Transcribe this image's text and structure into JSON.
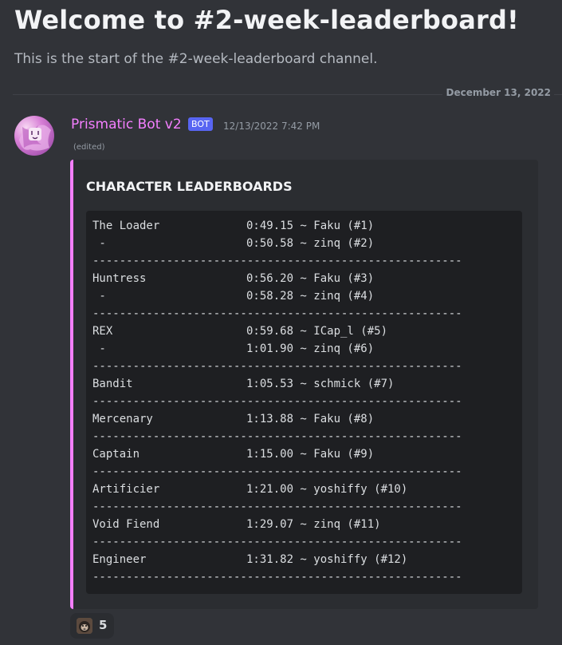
{
  "channel": {
    "welcome_title": "Welcome to #2-week-leaderboard!",
    "welcome_subtitle": "This is the start of the #2-week-leaderboard channel."
  },
  "divider": {
    "date": "December 13, 2022"
  },
  "message": {
    "author": "Prismatic Bot v2",
    "bot_tag": "BOT",
    "timestamp": "12/13/2022 7:42 PM",
    "edited": "(edited)",
    "embed": {
      "accent_color": "#f47fff",
      "title": "CHARACTER LEADERBOARDS",
      "separator": "-------------------------------------------------------",
      "groups": [
        {
          "rows": [
            {
              "name": "The Loader",
              "entry": "0:49.15 ~ Faku (#1)"
            },
            {
              "name": " -",
              "entry": "0:50.58 ~ zinq (#2)"
            }
          ]
        },
        {
          "rows": [
            {
              "name": "Huntress",
              "entry": "0:56.20 ~ Faku (#3)"
            },
            {
              "name": " -",
              "entry": "0:58.28 ~ zinq (#4)"
            }
          ]
        },
        {
          "rows": [
            {
              "name": "REX",
              "entry": "0:59.68 ~ ICap_l (#5)"
            },
            {
              "name": " -",
              "entry": "1:01.90 ~ zinq (#6)"
            }
          ]
        },
        {
          "rows": [
            {
              "name": "Bandit",
              "entry": "1:05.53 ~ schmick (#7)"
            }
          ]
        },
        {
          "rows": [
            {
              "name": "Mercenary",
              "entry": "1:13.88 ~ Faku (#8)"
            }
          ]
        },
        {
          "rows": [
            {
              "name": "Captain",
              "entry": "1:15.00 ~ Faku (#9)"
            }
          ]
        },
        {
          "rows": [
            {
              "name": "Artificier",
              "entry": "1:21.00 ~ yoshiffy (#10)"
            }
          ]
        },
        {
          "rows": [
            {
              "name": "Void Fiend",
              "entry": "1:29.07 ~ zinq (#11)"
            }
          ]
        },
        {
          "rows": [
            {
              "name": "Engineer",
              "entry": "1:31.82 ~ yoshiffy (#12)"
            }
          ]
        }
      ]
    },
    "reaction": {
      "emoji": "monkey-face-emoji",
      "count": "5"
    }
  },
  "colors": {
    "background": "#313338",
    "embed_background": "#2b2d31",
    "code_background": "#1e1f22",
    "author_color": "#f47fff",
    "bot_tag_color": "#5865f2"
  }
}
